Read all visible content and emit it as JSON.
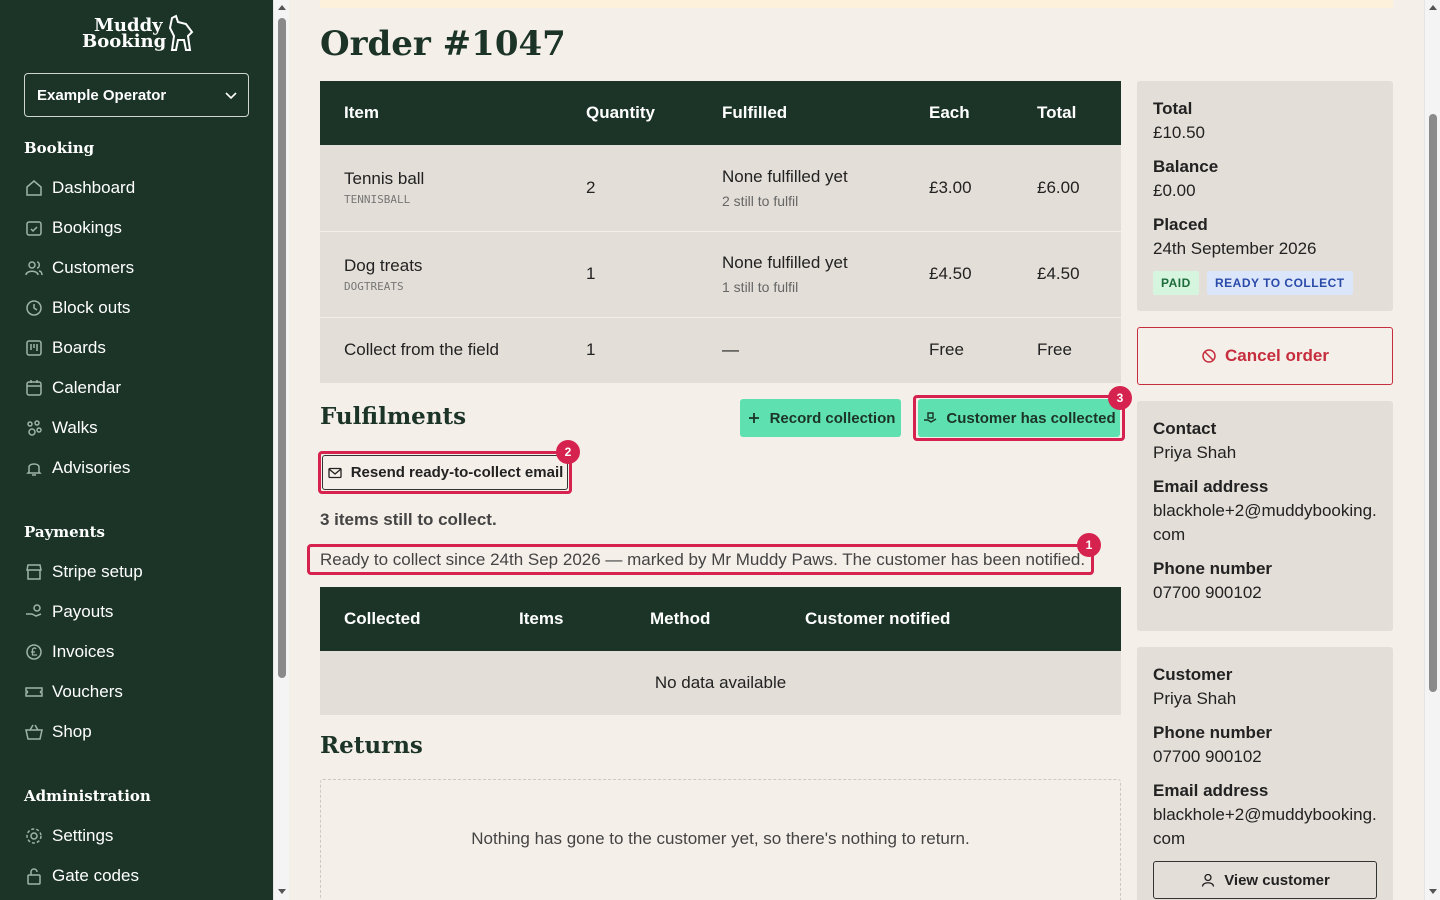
{
  "brand": {
    "line1": "Muddy",
    "line2": "Booking"
  },
  "org_select": {
    "value": "Example Operator"
  },
  "nav": {
    "booking_heading": "Booking",
    "booking": [
      {
        "label": "Dashboard",
        "icon": "home-icon"
      },
      {
        "label": "Bookings",
        "icon": "calendar-check-icon"
      },
      {
        "label": "Customers",
        "icon": "users-icon"
      },
      {
        "label": "Block outs",
        "icon": "clock-icon"
      },
      {
        "label": "Boards",
        "icon": "board-icon"
      },
      {
        "label": "Calendar",
        "icon": "calendar-icon"
      },
      {
        "label": "Walks",
        "icon": "paw-icon"
      },
      {
        "label": "Advisories",
        "icon": "bell-icon"
      }
    ],
    "payments_heading": "Payments",
    "payments": [
      {
        "label": "Stripe setup",
        "icon": "store-icon"
      },
      {
        "label": "Payouts",
        "icon": "hand-coins-icon"
      },
      {
        "label": "Invoices",
        "icon": "pound-circle-icon"
      },
      {
        "label": "Vouchers",
        "icon": "ticket-icon"
      },
      {
        "label": "Shop",
        "icon": "basket-icon"
      }
    ],
    "admin_heading": "Administration",
    "admin": [
      {
        "label": "Settings",
        "icon": "gear-icon"
      },
      {
        "label": "Gate codes",
        "icon": "lock-icon"
      }
    ]
  },
  "page": {
    "title": "Order #1047"
  },
  "items_table": {
    "headers": [
      "Item",
      "Quantity",
      "Fulfilled",
      "Each",
      "Total"
    ],
    "rows": [
      {
        "name": "Tennis ball",
        "sku": "TENNISBALL",
        "qty": "2",
        "fulfilled": "None fulfilled yet",
        "fulfil_sub": "2 still to fulfil",
        "each": "£3.00",
        "total": "£6.00"
      },
      {
        "name": "Dog treats",
        "sku": "DOGTREATS",
        "qty": "1",
        "fulfilled": "None fulfilled yet",
        "fulfil_sub": "1 still to fulfil",
        "each": "£4.50",
        "total": "£4.50"
      },
      {
        "name": "Collect from the field",
        "sku": "",
        "qty": "1",
        "fulfilled": "—",
        "fulfil_sub": "",
        "each": "Free",
        "total": "Free"
      }
    ]
  },
  "fulfilments": {
    "heading": "Fulfilments",
    "record_btn": "Record collection",
    "collected_btn": "Customer has collected",
    "resend_btn": "Resend ready-to-collect email",
    "remaining": "3 items still to collect.",
    "ready_note": "Ready to collect since 24th Sep 2026 — marked by Mr Muddy Paws. The customer has been notified.",
    "table_headers": [
      "Collected",
      "Items",
      "Method",
      "Customer notified"
    ],
    "empty": "No data available",
    "markers": [
      "1",
      "2",
      "3"
    ]
  },
  "returns": {
    "heading": "Returns",
    "empty": "Nothing has gone to the customer yet, so there's nothing to return."
  },
  "summary": {
    "total_label": "Total",
    "total": "£10.50",
    "balance_label": "Balance",
    "balance": "£0.00",
    "placed_label": "Placed",
    "placed": "24th September 2026",
    "badges": [
      "PAID",
      "READY TO COLLECT"
    ]
  },
  "cancel_btn": "Cancel order",
  "contact": {
    "contact_label": "Contact",
    "name": "Priya Shah",
    "email_label": "Email address",
    "email_l1": "blackhole+2@muddybooking.",
    "email_l2": "com",
    "phone_label": "Phone number",
    "phone": "07700 900102"
  },
  "customer": {
    "label": "Customer",
    "name": "Priya Shah",
    "phone_label": "Phone number",
    "phone": "07700 900102",
    "email_label": "Email address",
    "email_l1": "blackhole+2@muddybooking.",
    "email_l2": "com",
    "view_btn": "View customer"
  },
  "colors": {
    "sidebar": "#1b3427",
    "accent": "#5fe0b0",
    "danger": "#c62d3d",
    "highlight": "#d6224e"
  }
}
